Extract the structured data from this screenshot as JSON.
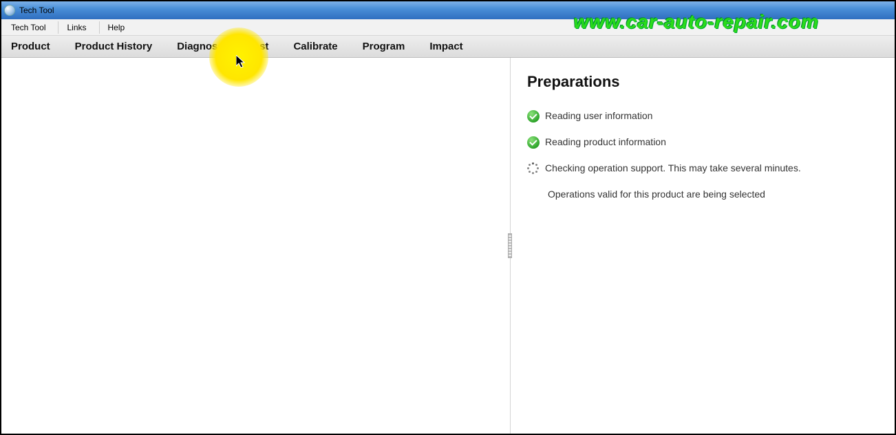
{
  "titlebar": {
    "title": "Tech Tool"
  },
  "menubar": {
    "items": [
      {
        "label": "Tech Tool"
      },
      {
        "label": "Links"
      },
      {
        "label": "Help"
      }
    ]
  },
  "tabs": [
    {
      "label": "Product"
    },
    {
      "label": "Product History"
    },
    {
      "label": "Diagnose"
    },
    {
      "label": "Test"
    },
    {
      "label": "Calibrate"
    },
    {
      "label": "Program"
    },
    {
      "label": "Impact"
    }
  ],
  "preparations": {
    "heading": "Preparations",
    "items": [
      {
        "status": "ok",
        "text": "Reading user information"
      },
      {
        "status": "ok",
        "text": "Reading product information"
      },
      {
        "status": "busy",
        "text": "Checking operation support. This may take several minutes."
      }
    ],
    "sub_text": "Operations valid for this product are being selected"
  },
  "watermark": "www.car-auto-repair.com"
}
